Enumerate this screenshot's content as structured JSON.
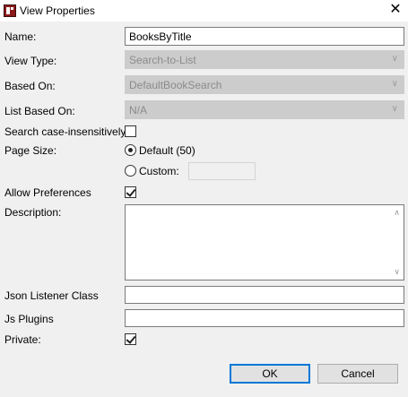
{
  "window": {
    "title": "View Properties",
    "icon": "app-icon",
    "close_icon": "close-icon"
  },
  "form": {
    "name": {
      "label": "Name:",
      "value": "BooksByTitle"
    },
    "view_type": {
      "label": "View Type:",
      "value": "Search-to-List"
    },
    "based_on": {
      "label": "Based On:",
      "value": "DefaultBookSearch"
    },
    "list_based_on": {
      "label": "List Based On:",
      "value": "N/A"
    },
    "search_case_insensitively": {
      "label": "Search case-insensitively",
      "checked": false
    },
    "page_size": {
      "label": "Page Size:",
      "default_label": "Default (50)",
      "custom_label": "Custom:",
      "selected": "default",
      "custom_value": ""
    },
    "allow_preferences": {
      "label": "Allow Preferences",
      "checked": true
    },
    "description": {
      "label": "Description:",
      "value": ""
    },
    "json_listener_class": {
      "label": "Json Listener Class",
      "value": ""
    },
    "js_plugins": {
      "label": "Js Plugins",
      "value": ""
    },
    "private": {
      "label": "Private:",
      "checked": true
    }
  },
  "buttons": {
    "ok": "OK",
    "cancel": "Cancel"
  }
}
